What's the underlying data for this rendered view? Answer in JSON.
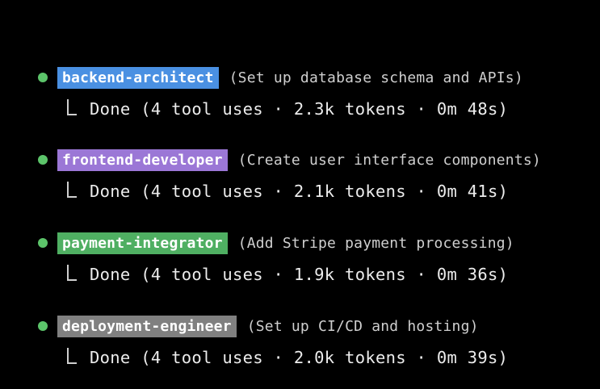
{
  "agents": [
    {
      "name": "backend-architect",
      "task": "(Set up database schema and APIs)",
      "result": "Done (4 tool uses · 2.3k tokens · 0m 48s)",
      "tag_color": "#4a90e2",
      "bullet_color": "#5cc46a"
    },
    {
      "name": "frontend-developer",
      "task": "(Create user interface components)",
      "result": "Done (4 tool uses · 2.1k tokens · 0m 41s)",
      "tag_color": "#9b77d6",
      "bullet_color": "#5cc46a"
    },
    {
      "name": "payment-integrator",
      "task": "(Add Stripe payment processing)",
      "result": "Done (4 tool uses · 1.9k tokens · 0m 36s)",
      "tag_color": "#4faf62",
      "bullet_color": "#5cc46a"
    },
    {
      "name": "deployment-engineer",
      "task": "(Set up CI/CD and hosting)",
      "result": "Done (4 tool uses · 2.0k tokens · 0m 39s)",
      "tag_color": "#808080",
      "bullet_color": "#5cc46a"
    }
  ],
  "icons": {
    "bullet": "status-dot-icon",
    "branch": "tree-branch-icon"
  }
}
